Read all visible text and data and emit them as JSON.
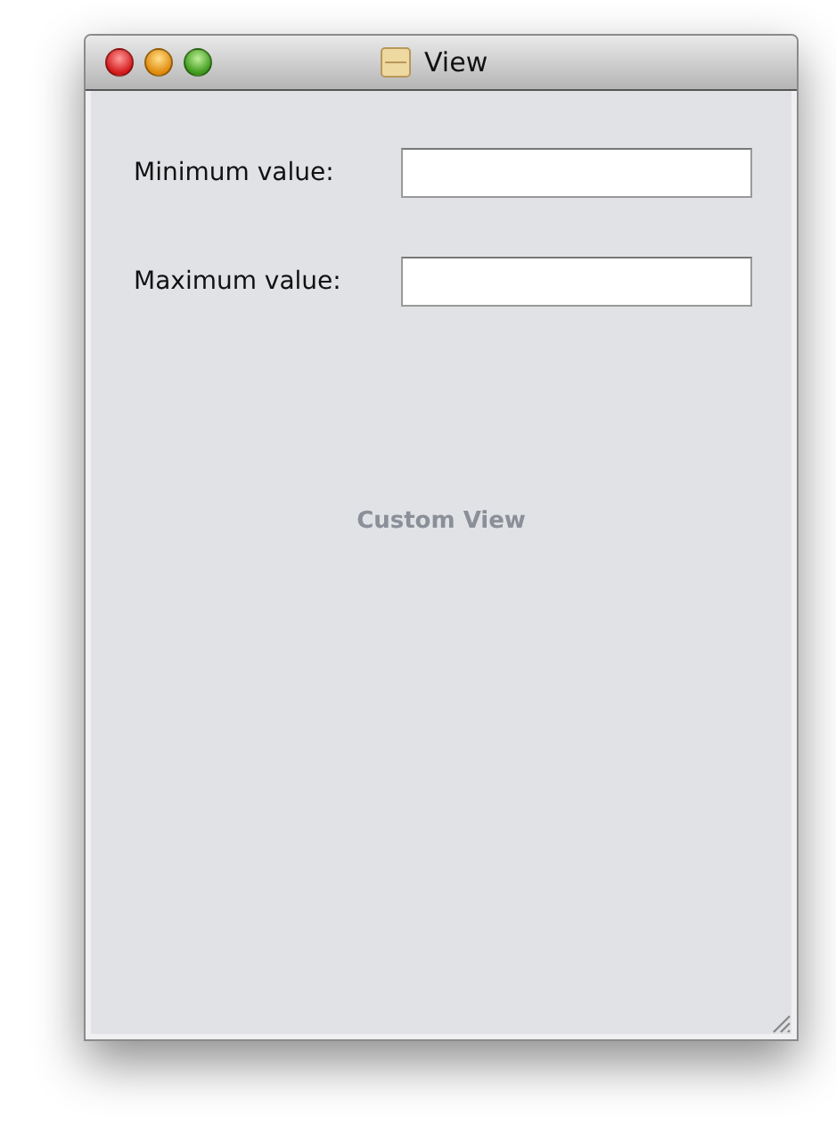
{
  "window": {
    "title": "View"
  },
  "fields": [
    {
      "label": "Minimum value:"
    },
    {
      "label": "Maximum value:"
    }
  ],
  "custom_view": {
    "label": "Custom View"
  }
}
